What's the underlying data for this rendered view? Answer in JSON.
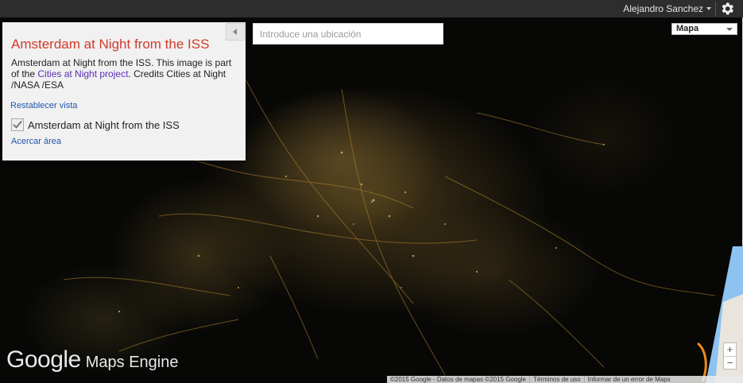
{
  "header": {
    "user_name": "Alejandro Sanchez",
    "settings_icon": "gear-icon"
  },
  "panel": {
    "title": "Amsterdam at Night from the ISS",
    "description_prefix": "Amsterdam at Night from the ISS. This image is part of the ",
    "description_link": "Cities at Night project",
    "description_suffix": ". Credits Cities at Night /NASA /ESA",
    "reset_view": "Restablecer vista",
    "layer_name": "Amsterdam at Night from the ISS",
    "layer_checked": true,
    "zoom_to_area": "Acercar área",
    "collapse_icon": "chevron-left-icon"
  },
  "search": {
    "placeholder": "Introduce una ubicación",
    "value": ""
  },
  "map_type": {
    "selected": "Mapa"
  },
  "zoom": {
    "in_label": "+",
    "out_label": "−"
  },
  "logo": {
    "google": "Google",
    "product": "Maps Engine"
  },
  "attribution": {
    "copyright": "©2015 Google - Datos de mapas ©2015 Google",
    "terms": "Términos de uso",
    "report": "Informar de un error de Maps"
  },
  "colors": {
    "title_red": "#d13b2b",
    "link_blue": "#2255aa",
    "link_purple": "#5b2fb3",
    "topbar": "#2d2d2d"
  }
}
